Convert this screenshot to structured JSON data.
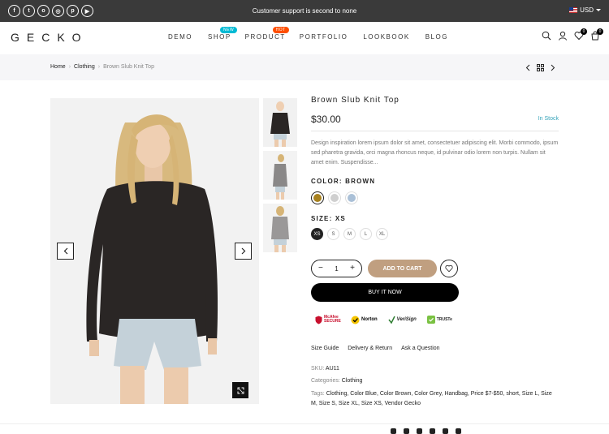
{
  "topbar": {
    "social": [
      "facebook-icon",
      "twitter-icon",
      "instagram-icon",
      "dribbble-icon",
      "pinterest-icon",
      "youtube-icon"
    ],
    "social_glyphs": [
      "f",
      "t",
      "o",
      "◎",
      "p",
      "▶"
    ],
    "message": "Customer support is second to none",
    "currency": "USD"
  },
  "header": {
    "logo": "GECKO",
    "nav": {
      "demo": "DEMO",
      "shop": "SHOP",
      "shop_badge": "NEW",
      "product": "PRODUCT",
      "product_badge": "HOT",
      "portfolio": "PORTFOLIO",
      "lookbook": "LOOKBOOK",
      "blog": "BLOG"
    },
    "wishlist_count": "0",
    "cart_count": "0"
  },
  "breadcrumb": {
    "home": "Home",
    "category": "Clothing",
    "current": "Brown Slub Knit Top",
    "separator": "›"
  },
  "product": {
    "title": "Brown Slub Knit Top",
    "price": "$30.00",
    "stock": "In Stock",
    "description": "Design inspiration lorem ipsum dolor sit amet, consectetuer adipiscing elit. Morbi commodo, ipsum sed pharetra gravida, orci magna rhoncus neque, id pulvinar odio lorem non turpis. Nullam sit amet enim. Suspendisse...",
    "color_label": "COLOR: BROWN",
    "colors": [
      "#a7811f",
      "#cfcfcf",
      "#aac0d7"
    ],
    "size_label": "SIZE: XS",
    "sizes": [
      "XS",
      "S",
      "M",
      "L",
      "XL"
    ],
    "quantity": "1",
    "qty_minus": "−",
    "qty_plus": "+",
    "add_to_cart": "ADD TO CART",
    "buy_now": "BUY IT NOW"
  },
  "trust_badges": {
    "mcafee": "McAfee SECURE",
    "norton": "Norton",
    "verisign": "VeriSign",
    "truste": "TRUSTe"
  },
  "links": {
    "size_guide": "Size Guide",
    "delivery": "Delivery & Return",
    "ask": "Ask a Question"
  },
  "meta": {
    "sku_label": "SKU:",
    "sku": "AU11",
    "categories_label": "Categories:",
    "categories": "Clothing",
    "tags_label": "Tags:",
    "tags": "Clothing, Color Blue, Color Brown, Color Grey, Handbag, Price $7-$50, short, Size L, Size M, Size S, Size XL, Size XS, Vendor Gecko"
  }
}
